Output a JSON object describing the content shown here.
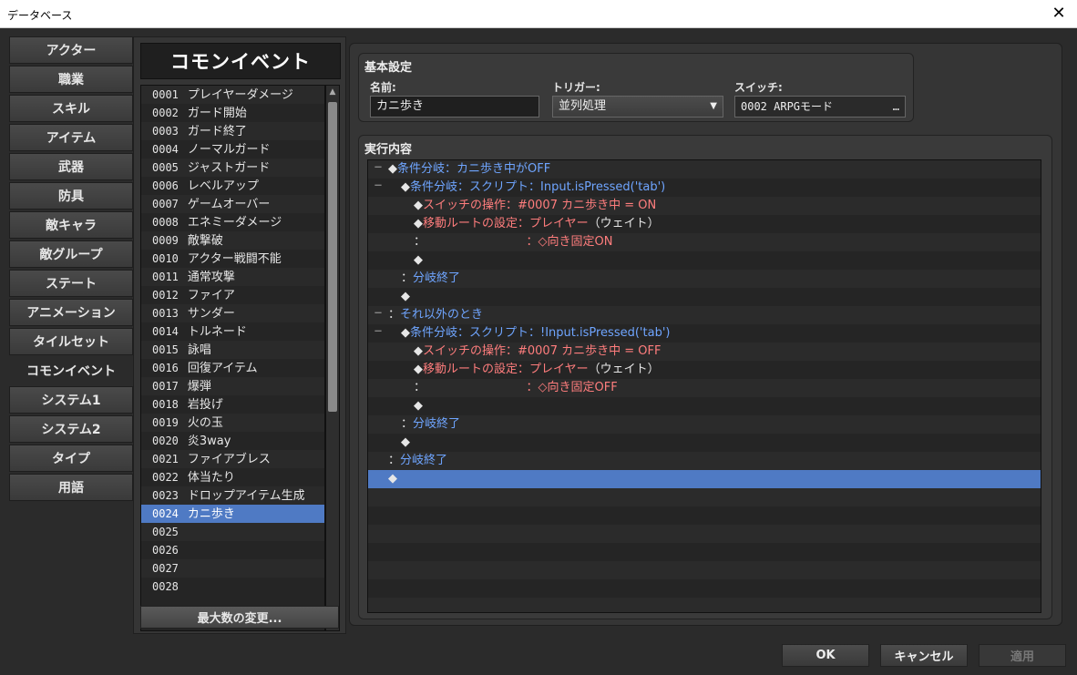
{
  "window": {
    "title": "データベース"
  },
  "tabs": [
    {
      "label": "アクター"
    },
    {
      "label": "職業"
    },
    {
      "label": "スキル"
    },
    {
      "label": "アイテム"
    },
    {
      "label": "武器"
    },
    {
      "label": "防具"
    },
    {
      "label": "敵キャラ"
    },
    {
      "label": "敵グループ"
    },
    {
      "label": "ステート"
    },
    {
      "label": "アニメーション"
    },
    {
      "label": "タイルセット"
    },
    {
      "label": "コモンイベント",
      "active": true
    },
    {
      "label": "システム1"
    },
    {
      "label": "システム2"
    },
    {
      "label": "タイプ"
    },
    {
      "label": "用語"
    }
  ],
  "list": {
    "header": "コモンイベント",
    "items": [
      {
        "num": "0001",
        "name": "プレイヤーダメージ"
      },
      {
        "num": "0002",
        "name": "ガード開始"
      },
      {
        "num": "0003",
        "name": "ガード終了"
      },
      {
        "num": "0004",
        "name": "ノーマルガード"
      },
      {
        "num": "0005",
        "name": "ジャストガード"
      },
      {
        "num": "0006",
        "name": "レベルアップ"
      },
      {
        "num": "0007",
        "name": "ゲームオーバー"
      },
      {
        "num": "0008",
        "name": "エネミーダメージ"
      },
      {
        "num": "0009",
        "name": "敵撃破"
      },
      {
        "num": "0010",
        "name": "アクター戦闘不能"
      },
      {
        "num": "0011",
        "name": "通常攻撃"
      },
      {
        "num": "0012",
        "name": "ファイア"
      },
      {
        "num": "0013",
        "name": "サンダー"
      },
      {
        "num": "0014",
        "name": "トルネード"
      },
      {
        "num": "0015",
        "name": "詠唱"
      },
      {
        "num": "0016",
        "name": "回復アイテム"
      },
      {
        "num": "0017",
        "name": "爆弾"
      },
      {
        "num": "0018",
        "name": "岩投げ"
      },
      {
        "num": "0019",
        "name": "火の玉"
      },
      {
        "num": "0020",
        "name": "炎3way"
      },
      {
        "num": "0021",
        "name": "ファイアブレス"
      },
      {
        "num": "0022",
        "name": "体当たり"
      },
      {
        "num": "0023",
        "name": "ドロップアイテム生成"
      },
      {
        "num": "0024",
        "name": "カニ歩き",
        "selected": true
      },
      {
        "num": "0025",
        "name": ""
      },
      {
        "num": "0026",
        "name": ""
      },
      {
        "num": "0027",
        "name": ""
      },
      {
        "num": "0028",
        "name": ""
      }
    ],
    "max_button": "最大数の変更..."
  },
  "basic": {
    "title": "基本設定",
    "name_label": "名前:",
    "name_value": "カニ歩き",
    "trigger_label": "トリガー:",
    "trigger_value": "並列処理",
    "switch_label": "スイッチ:",
    "switch_value": "0002 ARPGモード",
    "switch_dots": "…"
  },
  "contents": {
    "title": "実行内容",
    "lines": [
      {
        "indent": 0,
        "fold": "－",
        "parts": [
          {
            "c": "white",
            "t": "◆"
          },
          {
            "c": "blue",
            "t": "条件分岐：カニ歩き中がOFF"
          }
        ]
      },
      {
        "indent": 1,
        "fold": "－",
        "parts": [
          {
            "c": "white",
            "t": "◆"
          },
          {
            "c": "blue",
            "t": "条件分岐：スクリプト：Input.isPressed('tab')"
          }
        ]
      },
      {
        "indent": 2,
        "parts": [
          {
            "c": "white",
            "t": "◆"
          },
          {
            "c": "red",
            "t": "スイッチの操作：#0007 カニ歩き中 = ON"
          }
        ]
      },
      {
        "indent": 2,
        "parts": [
          {
            "c": "white",
            "t": "◆"
          },
          {
            "c": "red",
            "t": "移動ルートの設定：プレイヤー"
          },
          {
            "c": "white",
            "t": "（ウェイト）"
          }
        ]
      },
      {
        "indent": 2,
        "parts": [
          {
            "c": "white",
            "t": "："
          },
          {
            "c": "red",
            "t": "　　　　　　　　　：◇向き固定ON"
          }
        ]
      },
      {
        "indent": 2,
        "parts": [
          {
            "c": "white",
            "t": "◆"
          }
        ]
      },
      {
        "indent": 1,
        "parts": [
          {
            "c": "white",
            "t": "："
          },
          {
            "c": "blue",
            "t": "分岐終了"
          }
        ]
      },
      {
        "indent": 1,
        "parts": [
          {
            "c": "white",
            "t": "◆"
          }
        ]
      },
      {
        "indent": 0,
        "fold": "－",
        "parts": [
          {
            "c": "white",
            "t": "："
          },
          {
            "c": "blue",
            "t": "それ以外のとき"
          }
        ]
      },
      {
        "indent": 1,
        "fold": "－",
        "parts": [
          {
            "c": "white",
            "t": "◆"
          },
          {
            "c": "blue",
            "t": "条件分岐：スクリプト：!Input.isPressed('tab')"
          }
        ]
      },
      {
        "indent": 2,
        "parts": [
          {
            "c": "white",
            "t": "◆"
          },
          {
            "c": "red",
            "t": "スイッチの操作：#0007 カニ歩き中 = OFF"
          }
        ]
      },
      {
        "indent": 2,
        "parts": [
          {
            "c": "white",
            "t": "◆"
          },
          {
            "c": "red",
            "t": "移動ルートの設定：プレイヤー"
          },
          {
            "c": "white",
            "t": "（ウェイト）"
          }
        ]
      },
      {
        "indent": 2,
        "parts": [
          {
            "c": "white",
            "t": "："
          },
          {
            "c": "red",
            "t": "　　　　　　　　　：◇向き固定OFF"
          }
        ]
      },
      {
        "indent": 2,
        "parts": [
          {
            "c": "white",
            "t": "◆"
          }
        ]
      },
      {
        "indent": 1,
        "parts": [
          {
            "c": "white",
            "t": "："
          },
          {
            "c": "blue",
            "t": "分岐終了"
          }
        ]
      },
      {
        "indent": 1,
        "parts": [
          {
            "c": "white",
            "t": "◆"
          }
        ]
      },
      {
        "indent": 0,
        "parts": [
          {
            "c": "white",
            "t": "："
          },
          {
            "c": "blue",
            "t": "分岐終了"
          }
        ]
      },
      {
        "indent": 0,
        "selected": true,
        "parts": [
          {
            "c": "white",
            "t": "◆"
          }
        ]
      },
      {
        "indent": 0,
        "parts": []
      },
      {
        "indent": 0,
        "parts": []
      },
      {
        "indent": 0,
        "parts": []
      },
      {
        "indent": 0,
        "parts": []
      },
      {
        "indent": 0,
        "parts": []
      },
      {
        "indent": 0,
        "parts": []
      },
      {
        "indent": 0,
        "parts": []
      }
    ]
  },
  "buttons": {
    "ok": "OK",
    "cancel": "キャンセル",
    "apply": "適用"
  },
  "colors": {
    "accent": "#4f7ac4",
    "blue_text": "#6fa5ff",
    "red_text": "#ff7d7d"
  }
}
